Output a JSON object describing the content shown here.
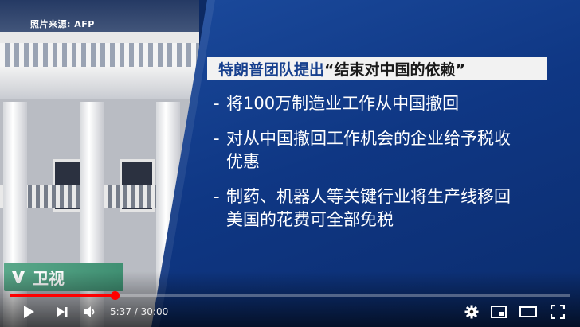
{
  "video": {
    "photo_credit": "照片来源: AFP",
    "headline_part1": "特朗普团队提出",
    "headline_part2": "“结束对中国的依赖”",
    "bullets": [
      {
        "dash": "-",
        "text": "将100万制造业工作从中国撤回"
      },
      {
        "dash": "-",
        "text": "对从中国撤回工作机会的企业给予税收优惠"
      },
      {
        "dash": "-",
        "text": "制药、机器人等关键行业将生产线移回美国的花费可全部免税"
      }
    ],
    "logo_text": "卫视"
  },
  "player": {
    "current_time": "5:37",
    "separator": " / ",
    "duration": "30:00",
    "progress": 0.187,
    "accent": "#ff0000",
    "icons": [
      "play-icon",
      "next-icon",
      "volume-icon",
      "gear-icon",
      "miniplayer-icon",
      "theater-icon",
      "fullscreen-icon"
    ]
  }
}
